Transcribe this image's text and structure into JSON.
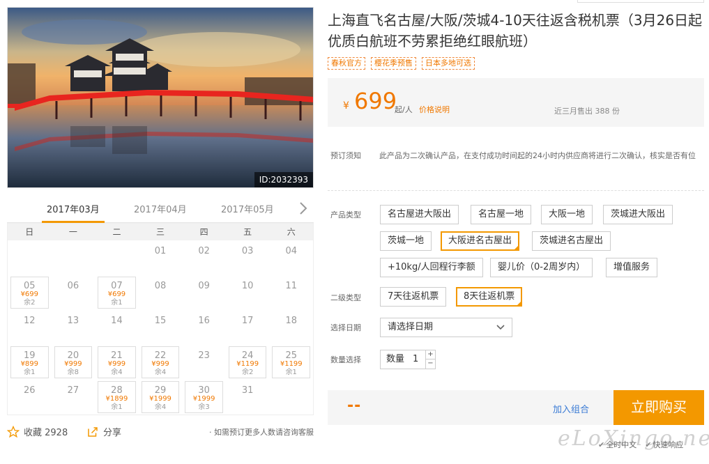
{
  "product": {
    "image_id": "ID:2032393",
    "title": "上海直飞名古屋/大阪/茨城4-10天往返含税机票（3月26日起优质白航班不劳累拒绝红眼航班）",
    "tags": [
      "春秋官方",
      "樱花季预售",
      "日本多地可选"
    ],
    "currency": "¥",
    "price": "699",
    "price_unit": "起/人",
    "price_note_link": "价格说明",
    "sold": "近三月售出 388 份"
  },
  "calendar": {
    "tabs": [
      "2017年03月",
      "2017年04月",
      "2017年05月"
    ],
    "active_tab": 0,
    "weekdays": [
      "日",
      "一",
      "二",
      "三",
      "四",
      "五",
      "六"
    ],
    "weeks": [
      [
        {
          "d": ""
        },
        {
          "d": ""
        },
        {
          "d": ""
        },
        {
          "d": "01"
        },
        {
          "d": "02"
        },
        {
          "d": "03"
        },
        {
          "d": "04"
        }
      ],
      [
        {
          "d": "05",
          "p": "¥699",
          "r": "余2"
        },
        {
          "d": "06"
        },
        {
          "d": "07",
          "p": "¥699",
          "r": "余1"
        },
        {
          "d": "08"
        },
        {
          "d": "09"
        },
        {
          "d": "10"
        },
        {
          "d": "11"
        }
      ],
      [
        {
          "d": "12"
        },
        {
          "d": "13"
        },
        {
          "d": "14"
        },
        {
          "d": "15"
        },
        {
          "d": "16"
        },
        {
          "d": "17"
        },
        {
          "d": "18"
        }
      ],
      [
        {
          "d": "19",
          "p": "¥899",
          "r": "余1"
        },
        {
          "d": "20",
          "p": "¥999",
          "r": "余8"
        },
        {
          "d": "21",
          "p": "¥999",
          "r": "余4"
        },
        {
          "d": "22",
          "p": "¥999",
          "r": "余4"
        },
        {
          "d": "23"
        },
        {
          "d": "24",
          "p": "¥1199",
          "r": "余2"
        },
        {
          "d": "25",
          "p": "¥1199",
          "r": "余1"
        }
      ],
      [
        {
          "d": "26"
        },
        {
          "d": "27"
        },
        {
          "d": "28",
          "p": "¥1899",
          "r": "余1"
        },
        {
          "d": "29",
          "p": "¥1999",
          "r": "余4"
        },
        {
          "d": "30",
          "p": "¥1999",
          "r": "余3"
        },
        {
          "d": "31"
        },
        {
          "d": ""
        }
      ]
    ]
  },
  "footer_left": {
    "favorite": "收藏 2928",
    "share": "分享",
    "consult": "· 如需预订更多人数请咨询客服"
  },
  "booking": {
    "notice_label": "预订须知",
    "notice_text": "此产品为二次确认产品，在支付成功时间起的24小时内供应商将进行二次确认，核实是否有位",
    "product_type_label": "产品类型",
    "product_types": [
      "名古屋进大阪出",
      "名古屋一地",
      "大阪一地",
      "茨城进大阪出",
      "茨城一地",
      "大阪进名古屋出",
      "茨城进名古屋出",
      "+10kg/人回程行李额",
      "婴儿价（0-2周岁内）",
      "增值服务"
    ],
    "product_type_selected": "大阪进名古屋出",
    "sub_type_label": "二级类型",
    "sub_types": [
      "7天往返机票",
      "8天往返机票"
    ],
    "sub_type_selected": "8天往返机票",
    "date_label": "选择日期",
    "date_placeholder": "请选择日期",
    "qty_label": "数量选择",
    "qty_prefix": "数量",
    "qty_value": "1",
    "total": "--",
    "add_combo": "加入组合",
    "buy_now": "立即购买"
  },
  "guarantees": [
    "全时中文",
    "快速响应"
  ],
  "watermark": "eLoXingo.net",
  "colors": {
    "accent": "#f39800",
    "price": "#f07800",
    "link": "#3a7bd5"
  }
}
